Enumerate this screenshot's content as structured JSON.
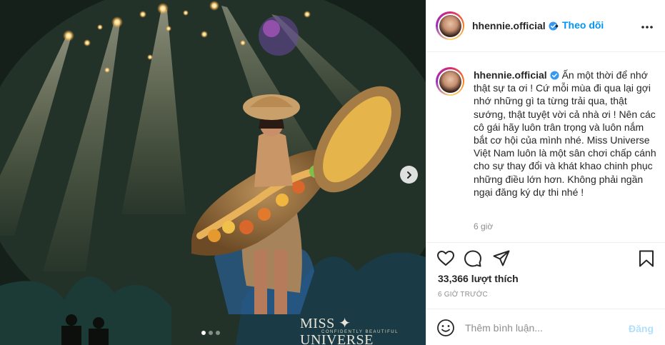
{
  "post": {
    "username": "hhennie.official",
    "separator": "•",
    "follow_label": "Theo dõi",
    "caption": "Ấn một thời để nhớ thật sự ta ơi ! Cứ mỗi mùa đi qua lại gợi nhớ những gì ta từng trải qua, thật sướng, thật tuyệt vời cả nhà ơi ! Nên các cô gái hãy luôn trân trọng và luôn nắm bắt cơ hội của mình nhé. Miss Universe Việt Nam luôn là một sân chơi chấp cánh cho sự thay đổi và khát khao chinh phục những điều lớn hơn. Không phải ngần ngại đăng ký dự thi nhé !",
    "caption_time": "6 giờ",
    "likes": "33,366 lượt thích",
    "timestamp": "6 GIỜ TRƯỚC"
  },
  "photo": {
    "watermark": "MISS ✦ UNIVERSE",
    "watermark_sub": "CONFIDENTLY BEAUTIFUL",
    "slide_count": 3,
    "active_slide": 1
  },
  "comment": {
    "placeholder": "Thêm bình luận...",
    "post_label": "Đăng"
  },
  "icons": {
    "verified": "verified-badge-icon",
    "more": "more-options-icon",
    "like": "heart-icon",
    "comment": "comment-bubble-icon",
    "share": "paper-plane-icon",
    "save": "bookmark-icon",
    "emoji": "smiley-icon",
    "next": "chevron-right-icon"
  },
  "colors": {
    "link_blue": "#0095f6",
    "verified_blue": "#3897f0",
    "post_disabled": "#b2dffc",
    "muted": "#8e8e8e"
  }
}
